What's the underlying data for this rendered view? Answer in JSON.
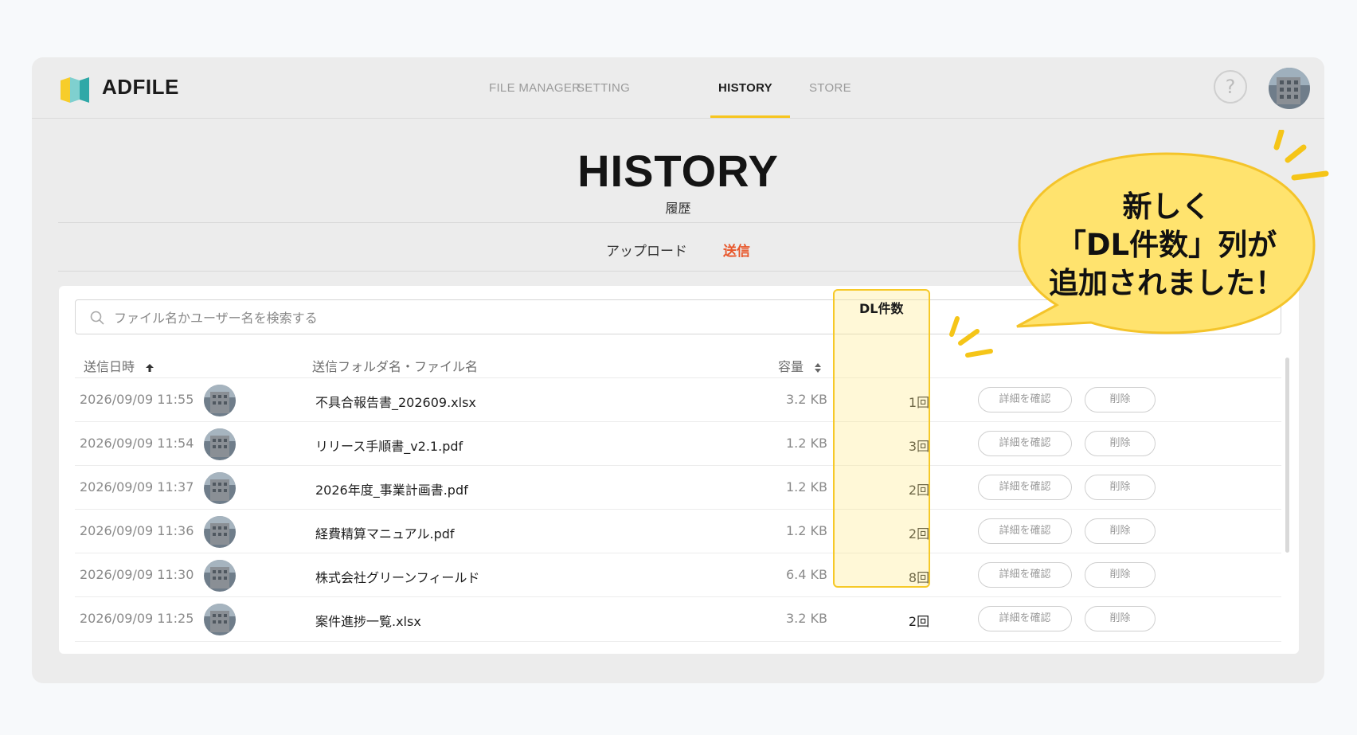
{
  "app": {
    "name": "ADFILE"
  },
  "nav": [
    {
      "label": "FILE MANAGER",
      "active": false
    },
    {
      "label": "SETTING",
      "active": false
    },
    {
      "label": "HISTORY",
      "active": true
    },
    {
      "label": "STORE",
      "active": false
    }
  ],
  "header_icons": {
    "help": "?"
  },
  "page": {
    "title": "HISTORY",
    "subtitle": "履歴"
  },
  "subtabs": [
    {
      "label": "アップロード",
      "active": false
    },
    {
      "label": "送信",
      "active": true
    }
  ],
  "search": {
    "placeholder": "ファイル名かユーザー名を検索する"
  },
  "table": {
    "headers": {
      "date": "送信日時",
      "name": "送信フォルダ名・ファイル名",
      "size": "容量",
      "dl": "DL件数"
    },
    "rows": [
      {
        "date": "2026/09/09 11:55",
        "name": "不具合報告書_202609.xlsx",
        "size": "3.2 KB",
        "dl": "1回",
        "detail": "詳細を確認",
        "delete": "削除"
      },
      {
        "date": "2026/09/09 11:54",
        "name": "リリース手順書_v2.1.pdf",
        "size": "1.2 KB",
        "dl": "3回",
        "detail": "詳細を確認",
        "delete": "削除"
      },
      {
        "date": "2026/09/09 11:37",
        "name": "2026年度_事業計画書.pdf",
        "size": "1.2 KB",
        "dl": "2回",
        "detail": "詳細を確認",
        "delete": "削除"
      },
      {
        "date": "2026/09/09 11:36",
        "name": "経費精算マニュアル.pdf",
        "size": "1.2 KB",
        "dl": "2回",
        "detail": "詳細を確認",
        "delete": "削除"
      },
      {
        "date": "2026/09/09 11:30",
        "name": "株式会社グリーンフィールド",
        "size": "6.4 KB",
        "dl": "8回",
        "detail": "詳細を確認",
        "delete": "削除"
      },
      {
        "date": "2026/09/09 11:25",
        "name": "案件進捗一覧.xlsx",
        "size": "3.2 KB",
        "dl": "2回",
        "detail": "詳細を確認",
        "delete": "削除"
      }
    ]
  },
  "callout": {
    "lines": [
      "新しく",
      "「DL件数」列が",
      "追加されました！"
    ]
  },
  "colors": {
    "accent": "#f7c51e",
    "active_subtab": "#e8562a",
    "callout_fill": "#ffe36e"
  }
}
